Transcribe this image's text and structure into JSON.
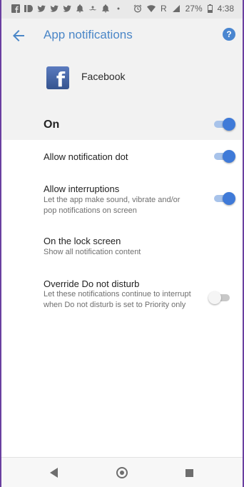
{
  "status_bar": {
    "icons": [
      "facebook-icon",
      "id-icon",
      "twitter-icon",
      "twitter-icon",
      "twitter-icon",
      "notification-bell-icon",
      "mustache-icon",
      "notification-bell-icon",
      "dots-icon"
    ],
    "right_icons": [
      "alarm-icon",
      "wifi-icon",
      "signal-icon"
    ],
    "roaming": "R",
    "battery": "27%",
    "time": "4:38"
  },
  "header": {
    "title": "App notifications",
    "help_symbol": "?"
  },
  "app": {
    "name": "Facebook",
    "icon_letter": "f"
  },
  "master_toggle": {
    "label": "On",
    "state": "on"
  },
  "settings": [
    {
      "title": "Allow notification dot",
      "desc": "",
      "toggle": "on"
    },
    {
      "title": "Allow interruptions",
      "desc": "Let the app make sound, vibrate and/or pop notifications on screen",
      "toggle": "on"
    },
    {
      "title": "On the lock screen",
      "desc": "Show all notification content",
      "toggle": null
    },
    {
      "title": "Override Do not disturb",
      "desc": "Let these notifications continue to interrupt when Do not disturb is set to Priority only",
      "toggle": "off"
    }
  ],
  "nav": {
    "icons": [
      "back-triangle-icon",
      "home-circle-icon",
      "recents-square-icon"
    ]
  },
  "colors": {
    "accent": "#4a86c7",
    "toggle_on": "#3f7ad8",
    "header_bg": "#f2f2f2"
  }
}
